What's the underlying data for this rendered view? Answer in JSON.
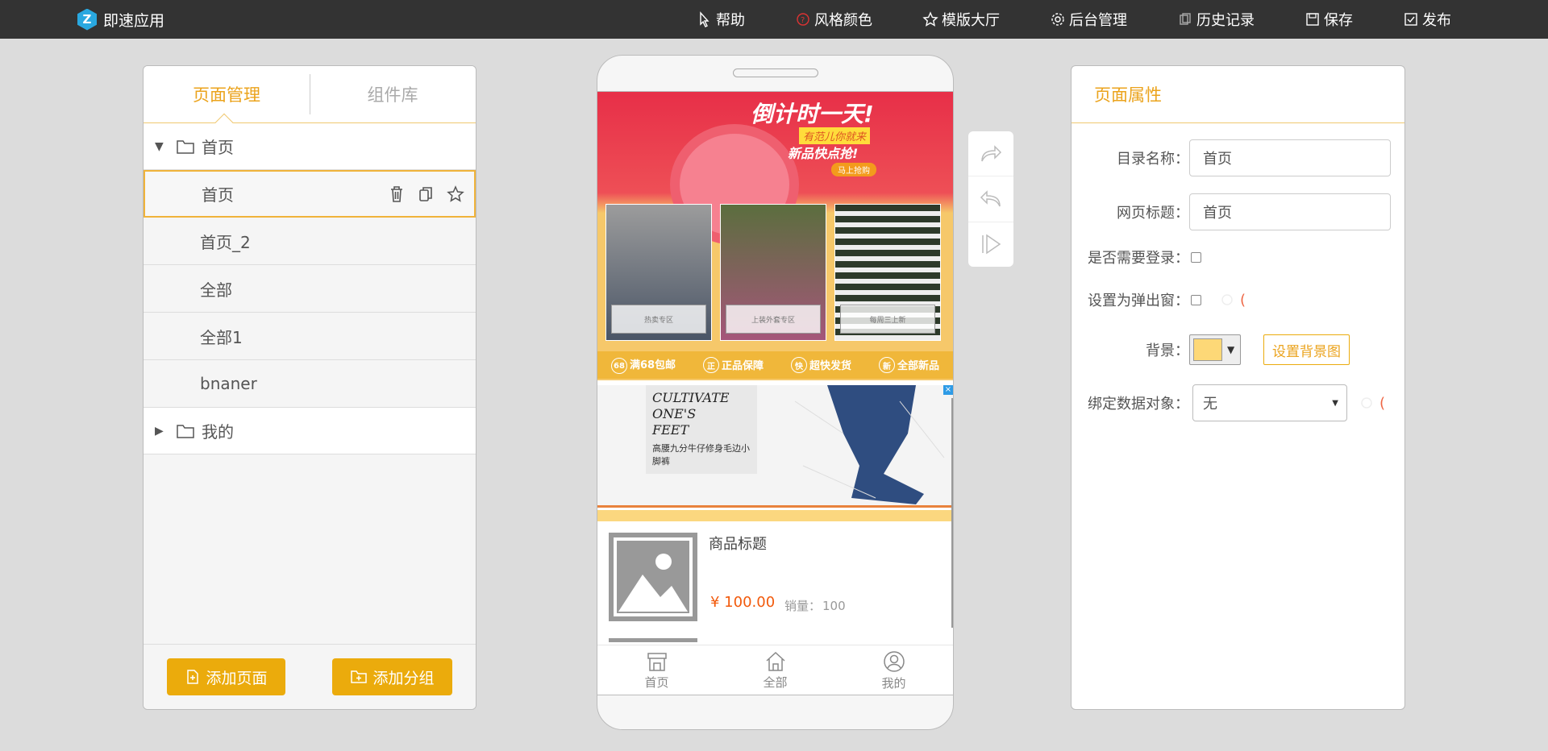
{
  "app": {
    "name": "即速应用",
    "logo_letter": "Z"
  },
  "topnav": [
    {
      "label": "帮助",
      "icon": "pointer-icon"
    },
    {
      "label": "风格颜色",
      "icon": "palette-icon"
    },
    {
      "label": "模版大厅",
      "icon": "star-icon"
    },
    {
      "label": "后台管理",
      "icon": "gear-icon"
    },
    {
      "label": "历史记录",
      "icon": "history-icon"
    },
    {
      "label": "保存",
      "icon": "save-icon"
    },
    {
      "label": "发布",
      "icon": "publish-icon"
    }
  ],
  "left_panel": {
    "tabs": [
      "页面管理",
      "组件库"
    ],
    "groups": [
      {
        "label": "首页",
        "expanded": true,
        "items": [
          "首页",
          "首页_2",
          "全部",
          "全部1",
          "bnaner"
        ]
      },
      {
        "label": "我的",
        "expanded": false
      }
    ],
    "add_page": "添加页面",
    "add_group": "添加分组"
  },
  "phone": {
    "banner": {
      "title": "倒计时一天!",
      "sub1": "有范儿你就来",
      "sub2": "新品快点抢!",
      "button": "马上抢购",
      "photos": [
        "热卖专区",
        "上装外套专区",
        "每周三上新"
      ],
      "features": [
        {
          "icon": "68",
          "label": "满68包邮"
        },
        {
          "icon": "正",
          "label": "正品保障"
        },
        {
          "icon": "快",
          "label": "超快发货"
        },
        {
          "icon": "新",
          "label": "全部新品"
        }
      ]
    },
    "ad": {
      "heading_line1": "CULTIVATE ONE'S",
      "heading_line2": "FEET",
      "subtitle": "高腰九分牛仔修身毛边小脚裤",
      "close": "×"
    },
    "product": {
      "title": "商品标题",
      "price": "¥ 100.00",
      "sales_label": "销量：",
      "sales_value": "100"
    },
    "tabbar": [
      {
        "label": "首页",
        "icon": "shop-icon"
      },
      {
        "label": "全部",
        "icon": "home-icon"
      },
      {
        "label": "我的",
        "icon": "user-icon"
      }
    ]
  },
  "right_panel": {
    "title": "页面属性",
    "dir_name_label": "目录名称：",
    "dir_name_value": "首页",
    "page_title_label": "网页标题：",
    "page_title_value": "首页",
    "need_login_label": "是否需要登录：",
    "popup_label": "设置为弹出窗：",
    "popup_hint": "(",
    "bg_label": "背景：",
    "bg_color": "#fdd877",
    "bg_button": "设置背景图",
    "bind_label": "绑定数据对象：",
    "bind_value": "无",
    "bind_hint": "("
  },
  "colors": {
    "accent": "#eba31c",
    "button": "#ebab0c",
    "price": "#f25a0c",
    "topbar": "#333333"
  }
}
